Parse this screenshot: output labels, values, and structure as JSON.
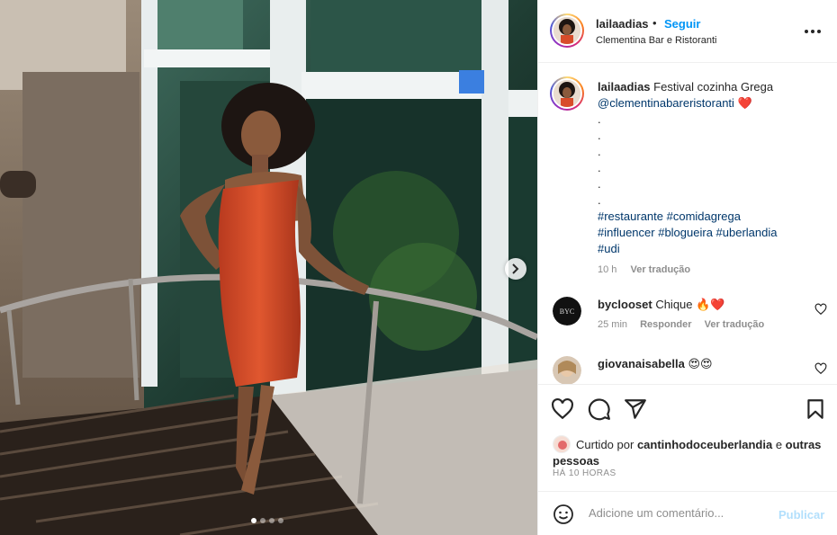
{
  "post": {
    "username": "lailaadias",
    "separator": "•",
    "follow_label": "Seguir",
    "location": "Clementina Bar e Ristoranti",
    "more_icon": "more-options-icon"
  },
  "caption": {
    "username": "lailaadias",
    "text": "Festival cozinha Grega",
    "mention": "@clementinabareristoranti",
    "heart": "❤️",
    "dot_lines": [
      ".",
      ".",
      ".",
      ".",
      ".",
      "."
    ],
    "hashtags_line1": "#restaurante #comidagrega",
    "hashtags_line2": "#influencer #blogueira #uberlandia",
    "hashtags_line3": "#udi",
    "time": "10 h",
    "translate": "Ver tradução"
  },
  "comments": [
    {
      "username": "byclooset",
      "text": "Chique 🔥❤️",
      "time": "25 min",
      "reply": "Responder",
      "translate": "Ver tradução",
      "avatar_text": "BYC"
    },
    {
      "username": "giovanaisabella",
      "text": "😍😍"
    }
  ],
  "likes": {
    "prefix": "Curtido por",
    "user": "cantinhodoceuberlandia",
    "and": "e",
    "others": "outras pessoas"
  },
  "timestamp": "HÁ 10 HORAS",
  "add_comment": {
    "placeholder": "Adicione um comentário...",
    "publish": "Publicar"
  },
  "carousel": {
    "slides": 4,
    "active": 1
  },
  "colors": {
    "link_blue": "#0095f6",
    "hashtag": "#00376b",
    "muted": "#8e8e8e",
    "dress": "#d84c2a"
  }
}
